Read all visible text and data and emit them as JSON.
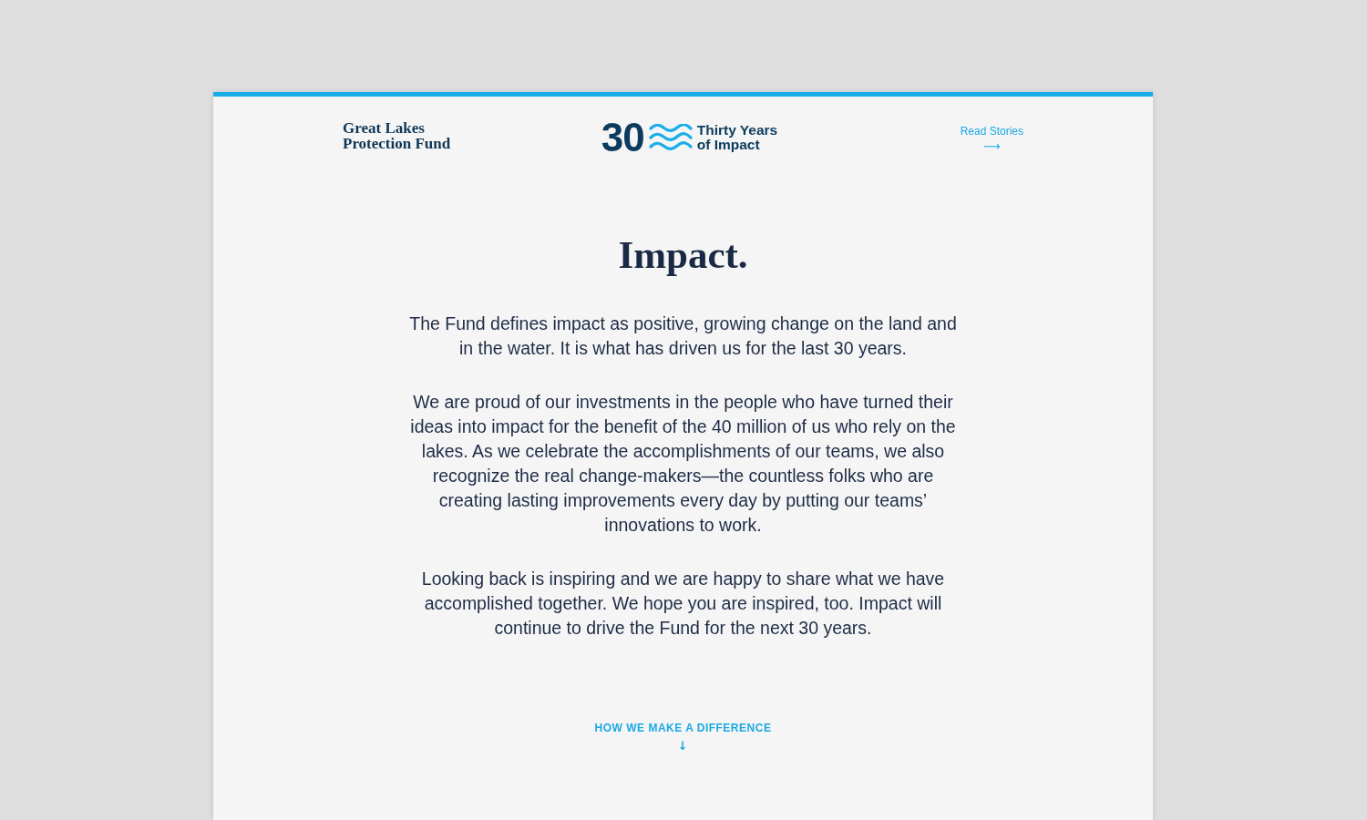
{
  "header": {
    "org_name_lines": [
      "Great Lakes",
      "Protection Fund"
    ],
    "anniversary": {
      "number": "30",
      "tagline_lines": [
        "Thirty Years",
        "of Impact"
      ]
    },
    "nav_link": {
      "label": "Read Stories",
      "arrow": "⟶"
    }
  },
  "title": "Impact.",
  "paragraphs": [
    "The Fund defines impact as positive, growing change on the land and in the water. It is what has driven us for the last 30 years.",
    "We are proud of our investments in the people who have turned their ideas into impact for the benefit of the 40 million of us who rely on the lakes. As we celebrate the accomplishments of our teams, we also recognize the real change-makers—the countless folks who are creating lasting improvements every day by putting our teams’ innovations to work.",
    "Looking back is inspiring and we are happy to share what we have accomplished together. We hope you are inspired, too. Impact will continue to drive the Fund for the next 30 years."
  ],
  "scroll_cue": {
    "label": "HOW WE MAKE A DIFFERENCE",
    "arrow": "↓"
  }
}
